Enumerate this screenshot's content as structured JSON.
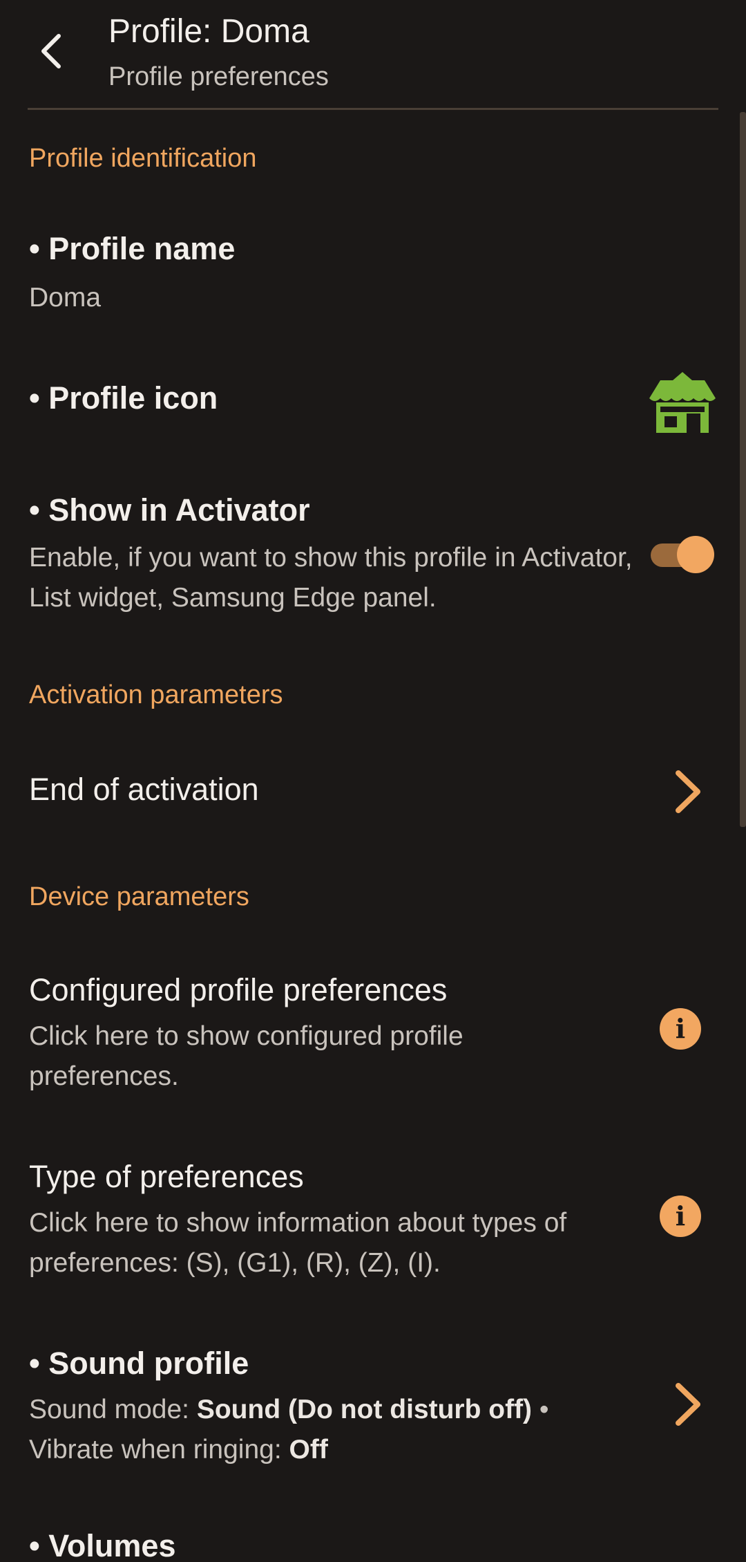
{
  "header": {
    "title": "Profile: Doma",
    "subtitle": "Profile preferences"
  },
  "sections": {
    "identification": "Profile identification",
    "activation": "Activation parameters",
    "device": "Device parameters"
  },
  "profile_name": {
    "title": "• Profile name",
    "value": "Doma"
  },
  "profile_icon": {
    "title": "• Profile icon",
    "icon": "house-icon",
    "icon_color": "#7cb83a"
  },
  "show_in_activator": {
    "title": "• Show in Activator",
    "summary": "Enable, if you want to show this profile in Activator, List widget, Samsung Edge panel.",
    "checked": true
  },
  "end_of_activation": {
    "title": "End of activation"
  },
  "configured_prefs": {
    "title": "Configured profile preferences",
    "summary": "Click here to show configured profile preferences."
  },
  "type_of_prefs": {
    "title": "Type of preferences",
    "summary": "Click here to show information about types of preferences: (S), (G1), (R), (Z), (I)."
  },
  "sound_profile": {
    "title": "• Sound profile",
    "mode_label": "Sound mode: ",
    "mode_value": "Sound (Do not disturb off)",
    "separator": " • ",
    "vibrate_label": "Vibrate when ringing: ",
    "vibrate_value": "Off"
  },
  "volumes": {
    "title": "• Volumes"
  },
  "colors": {
    "accent": "#f0a65f",
    "background": "#1b1817"
  }
}
